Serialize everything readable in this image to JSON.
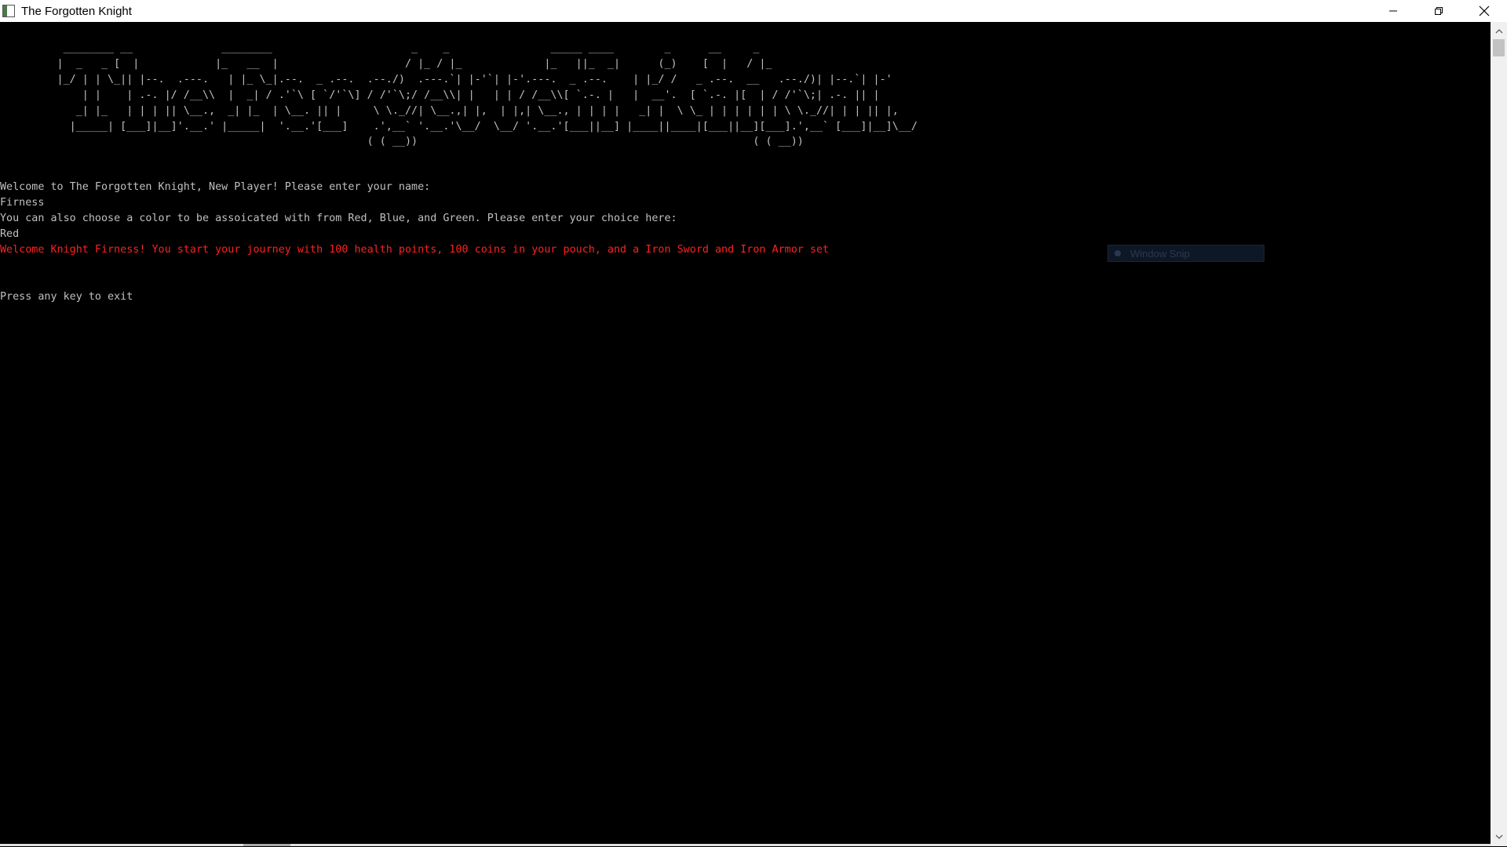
{
  "window": {
    "title": "The Forgotten Knight",
    "controls": [
      "minimize",
      "restore",
      "close"
    ]
  },
  "console": {
    "banner_lines": [
      "          ________ __              ________                      _    _                _____ ____        _      __     _",
      "         |  _   _ [  |            |_   __  |                    / |_ / |_             |_   ||_  _|      (_)    [  |   / |_",
      "         |_/ | | \\_|| |--.  .---.   | |_ \\_|.--.  _ .--.  .--./)  .---.`| |-'`| |-'.---.  _ .--.    | |_/ /   _ .--.  __   .--./)| |--.`| |-'",
      "             | |    | .-. |/ /__\\\\  |  _| / .'`\\ [ `/'`\\] / /'`\\;/ /__\\\\| |   | | / /__\\\\[ `.-. |   |  __'.  [ `.-. |[  | / /'`\\;| .-. || |",
      "            _| |_   | | | || \\__.,  _| |_  | \\__. || |     \\ \\._//| \\__.,| |,  | |,| \\__., | | | |   _| |  \\ \\_ | | | | | | \\ \\._//| | | || |,",
      "           |_____| [___]|__]'.__.' |_____|  '.__.'[___]    .',__` '.__.'\\__/  \\__/ '.__.'[___||__] |____||____|[___||__][___].',__` [___]|__]\\__/",
      "                                                          ( ( __))                                                     ( ( __))"
    ],
    "lines": [
      {
        "text": "Welcome to The Forgotten Knight, New Player! Please enter your name:",
        "color": "default"
      },
      {
        "text": "Firness",
        "color": "default"
      },
      {
        "text": "You can also choose a color to be assoicated with from Red, Blue, and Green. Please enter your choice here:",
        "color": "default"
      },
      {
        "text": "Red",
        "color": "default"
      },
      {
        "text": "Welcome Knight Firness! You start your journey with 100 health points, 100 coins in your pouch, and a Iron Sword and Iron Armor set",
        "color": "red"
      },
      {
        "text": "",
        "color": "default"
      },
      {
        "text": "",
        "color": "default"
      },
      {
        "text": "Press any key to exit",
        "color": "default"
      }
    ]
  },
  "overlay": {
    "snip_label": "Window Snip"
  },
  "colors": {
    "console_bg": "#000000",
    "console_text": "#c0c0c0",
    "highlight_text": "#ff2020",
    "titlebar_bg": "#ffffff"
  }
}
